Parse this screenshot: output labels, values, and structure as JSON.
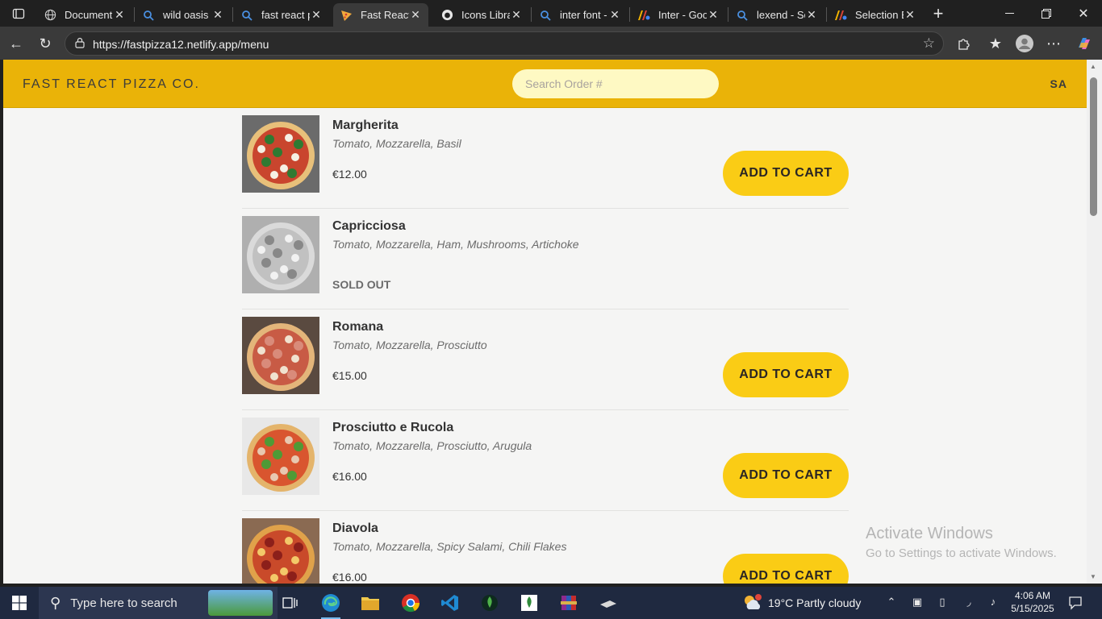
{
  "browser": {
    "tabs": [
      {
        "label": "Document",
        "icon": "globe-icon"
      },
      {
        "label": "wild oasis -",
        "icon": "search-icon"
      },
      {
        "label": "fast react pi",
        "icon": "search-icon"
      },
      {
        "label": "Fast React P",
        "icon": "pizza-icon",
        "active": true
      },
      {
        "label": "Icons Librar",
        "icon": "github-icon"
      },
      {
        "label": "inter font -",
        "icon": "search-icon"
      },
      {
        "label": "Inter - Goo",
        "icon": "google-fonts-icon"
      },
      {
        "label": "lexend - Se",
        "icon": "search-icon"
      },
      {
        "label": "Selection Er",
        "icon": "google-fonts-icon"
      }
    ],
    "close_glyph": "✕",
    "new_tab_glyph": "+",
    "url": "https://fastpizza12.netlify.app/menu"
  },
  "app": {
    "brand": "FAST REACT PIZZA CO.",
    "search_placeholder": "Search Order #",
    "username": "SA",
    "add_to_cart_label": "ADD TO CART",
    "sold_out_label": "SOLD OUT",
    "colors": {
      "header": "#eab308",
      "button": "#facc15",
      "search_bg": "#fef9c3",
      "page_bg": "#f5f5f4"
    }
  },
  "menu": [
    {
      "name": "Margherita",
      "ingredients": "Tomato, Mozzarella, Basil",
      "price": "€12.00",
      "sold_out": false
    },
    {
      "name": "Capricciosa",
      "ingredients": "Tomato, Mozzarella, Ham, Mushrooms, Artichoke",
      "price": "",
      "sold_out": true
    },
    {
      "name": "Romana",
      "ingredients": "Tomato, Mozzarella, Prosciutto",
      "price": "€15.00",
      "sold_out": false
    },
    {
      "name": "Prosciutto e Rucola",
      "ingredients": "Tomato, Mozzarella, Prosciutto, Arugula",
      "price": "€16.00",
      "sold_out": false
    },
    {
      "name": "Diavola",
      "ingredients": "Tomato, Mozzarella, Spicy Salami, Chili Flakes",
      "price": "€16.00",
      "sold_out": false
    }
  ],
  "watermark": {
    "line1": "Activate Windows",
    "line2": "Go to Settings to activate Windows."
  },
  "taskbar": {
    "search_placeholder": "Type here to search",
    "weather": "19°C  Partly cloudy",
    "time": "4:06 AM",
    "date": "5/15/2025"
  }
}
